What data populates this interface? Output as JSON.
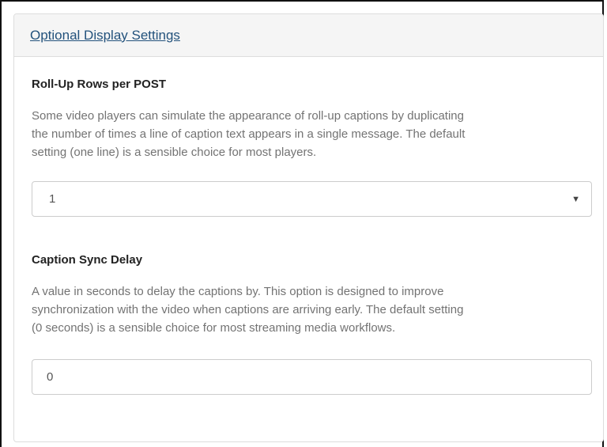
{
  "panel": {
    "title": "Optional Display Settings"
  },
  "roll_up": {
    "label": "Roll-Up Rows per POST",
    "help_line_1": "Some video players can simulate the appearance of roll-up captions by duplicating",
    "help_line_2": "the number of times a line of caption text appears in a single message. The default",
    "help_line_3": "setting (one line) is a sensible choice for most players.",
    "selected_value": "1",
    "caret_icon": "chevron-down-icon"
  },
  "sync_delay": {
    "label": "Caption Sync Delay",
    "help_line_1": "A value in seconds to delay the captions by. This option is designed to improve",
    "help_line_2": "synchronization with the video when captions are arriving early. The default setting",
    "help_line_3": "(0 seconds) is a sensible choice for most streaming media workflows.",
    "value": "0"
  },
  "colors": {
    "link": "#23527c",
    "heading_bg": "#f5f5f5",
    "help_text": "#737373",
    "border": "#dddddd"
  }
}
